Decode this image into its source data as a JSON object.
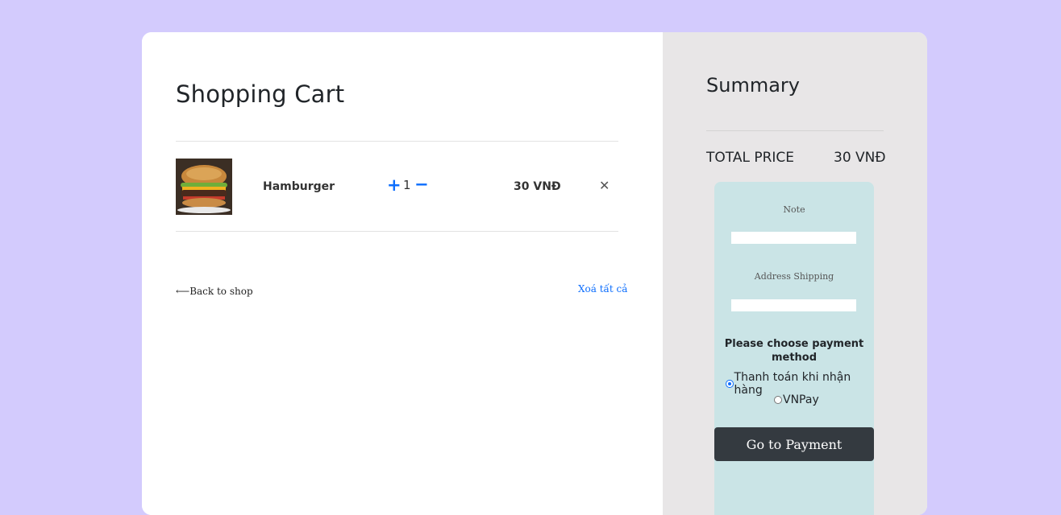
{
  "cart": {
    "title": "Shopping Cart",
    "items": [
      {
        "name": "Hamburger",
        "quantity": "1",
        "plus": "+",
        "minus": "−",
        "price": "30 VNĐ",
        "remove": "✕",
        "image_icon": "hamburger-image"
      }
    ],
    "back_link": "⟵Back to shop",
    "clear_all": "Xoá tất cả"
  },
  "summary": {
    "title": "Summary",
    "total_label": "TOTAL PRICE",
    "total_value": "30 VNĐ",
    "note_label": "Note",
    "note_value": "",
    "address_label": "Address Shipping",
    "address_value": "",
    "payment_heading": "Please choose payment method",
    "payment_options": [
      {
        "label": "Thanh toán khi nhận hàng",
        "checked": true
      },
      {
        "label": "VNPay",
        "checked": false
      }
    ],
    "pay_button": "Go to Payment"
  },
  "colors": {
    "background": "#d3cbfd",
    "accent": "#0d6efd",
    "summary_bg": "#e8e6e7",
    "form_bg": "#cae4e6",
    "button_bg": "#343a40"
  }
}
